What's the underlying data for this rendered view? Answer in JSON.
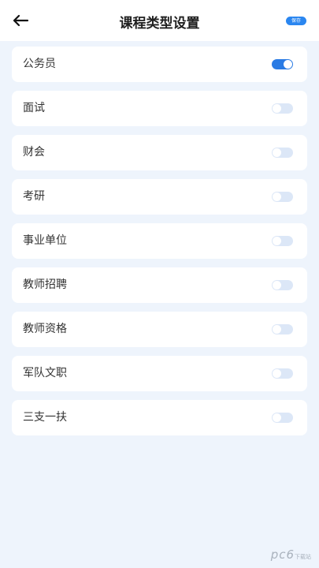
{
  "header": {
    "title": "课程类型设置",
    "save_label": "保存",
    "back_icon": "arrow-left-icon"
  },
  "categories": [
    {
      "label": "公务员",
      "enabled": true
    },
    {
      "label": "面试",
      "enabled": false
    },
    {
      "label": "财会",
      "enabled": false
    },
    {
      "label": "考研",
      "enabled": false
    },
    {
      "label": "事业单位",
      "enabled": false
    },
    {
      "label": "教师招聘",
      "enabled": false
    },
    {
      "label": "教师资格",
      "enabled": false
    },
    {
      "label": "军队文职",
      "enabled": false
    },
    {
      "label": "三支一扶",
      "enabled": false
    }
  ],
  "colors": {
    "accent": "#2a7be4",
    "background": "#eef4fc",
    "toggle_off": "#dce7f7"
  },
  "watermark": {
    "text": "pc6",
    "ext": "下载站"
  }
}
